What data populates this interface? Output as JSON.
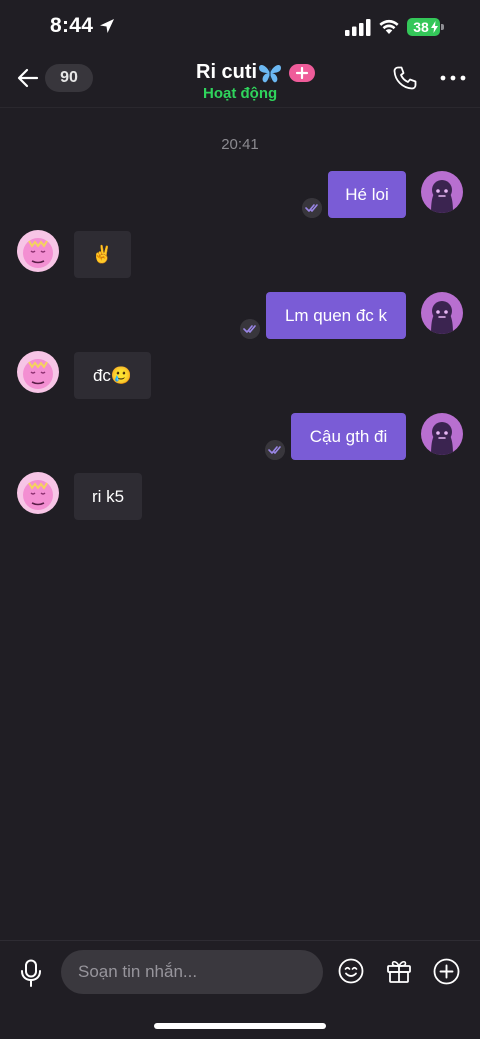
{
  "status_bar": {
    "time": "8:44",
    "battery": "38"
  },
  "header": {
    "back_count": "90",
    "contact_name": "Ri cuti",
    "contact_status": "Hoạt động",
    "icons": [
      "back-arrow-icon",
      "butterfly-icon",
      "plus-icon",
      "phone-icon",
      "more-icon"
    ]
  },
  "chat": {
    "timestamp": "20:41",
    "messages": [
      {
        "from": "me",
        "text": "Hé loi",
        "read": true
      },
      {
        "from": "them",
        "text": "✌️"
      },
      {
        "from": "me",
        "text": "Lm quen đc k",
        "read": true
      },
      {
        "from": "them",
        "text": "đc🥲"
      },
      {
        "from": "me",
        "text": "Cậu gth đi",
        "read": true
      },
      {
        "from": "them",
        "text": "ri k5"
      }
    ]
  },
  "composer": {
    "placeholder": "Soạn tin nhắn...",
    "icons": [
      "microphone-icon",
      "emoji-icon",
      "gift-icon",
      "add-icon"
    ]
  },
  "colors": {
    "background": "#201e24",
    "outgoing_bubble": "#7a5cd6",
    "incoming_bubble": "#2e2c33",
    "status_online": "#2fd45c",
    "badge_pink": "#ef5c9a"
  }
}
